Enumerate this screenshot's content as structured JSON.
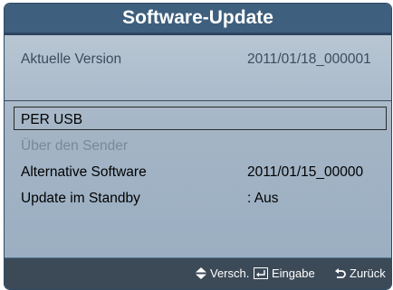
{
  "dialog": {
    "title": "Software-Update",
    "current_version_label": "Aktuelle Version",
    "current_version_value": "2011/01/18_000001"
  },
  "menu": {
    "items": [
      {
        "label": "PER USB",
        "value": "",
        "selected": true,
        "enabled": true
      },
      {
        "label": "Über den Sender",
        "value": "",
        "selected": false,
        "enabled": false
      },
      {
        "label": "Alternative Software",
        "value": "2011/01/15_00000",
        "selected": false,
        "enabled": true
      },
      {
        "label": "Update im Standby",
        "value": ": Aus",
        "selected": false,
        "enabled": true
      }
    ]
  },
  "footer": {
    "move_label": "Versch.",
    "enter_label": "Eingabe",
    "back_label": "Zurück",
    "icons": [
      "up-down-arrow-icon",
      "enter-icon",
      "return-icon"
    ]
  },
  "colors": {
    "title_bar": "#3e5f7d",
    "body_gradient_top": "#b8c6d3",
    "footer_bar": "#3c4a58",
    "disabled_text": "#7c8896"
  }
}
